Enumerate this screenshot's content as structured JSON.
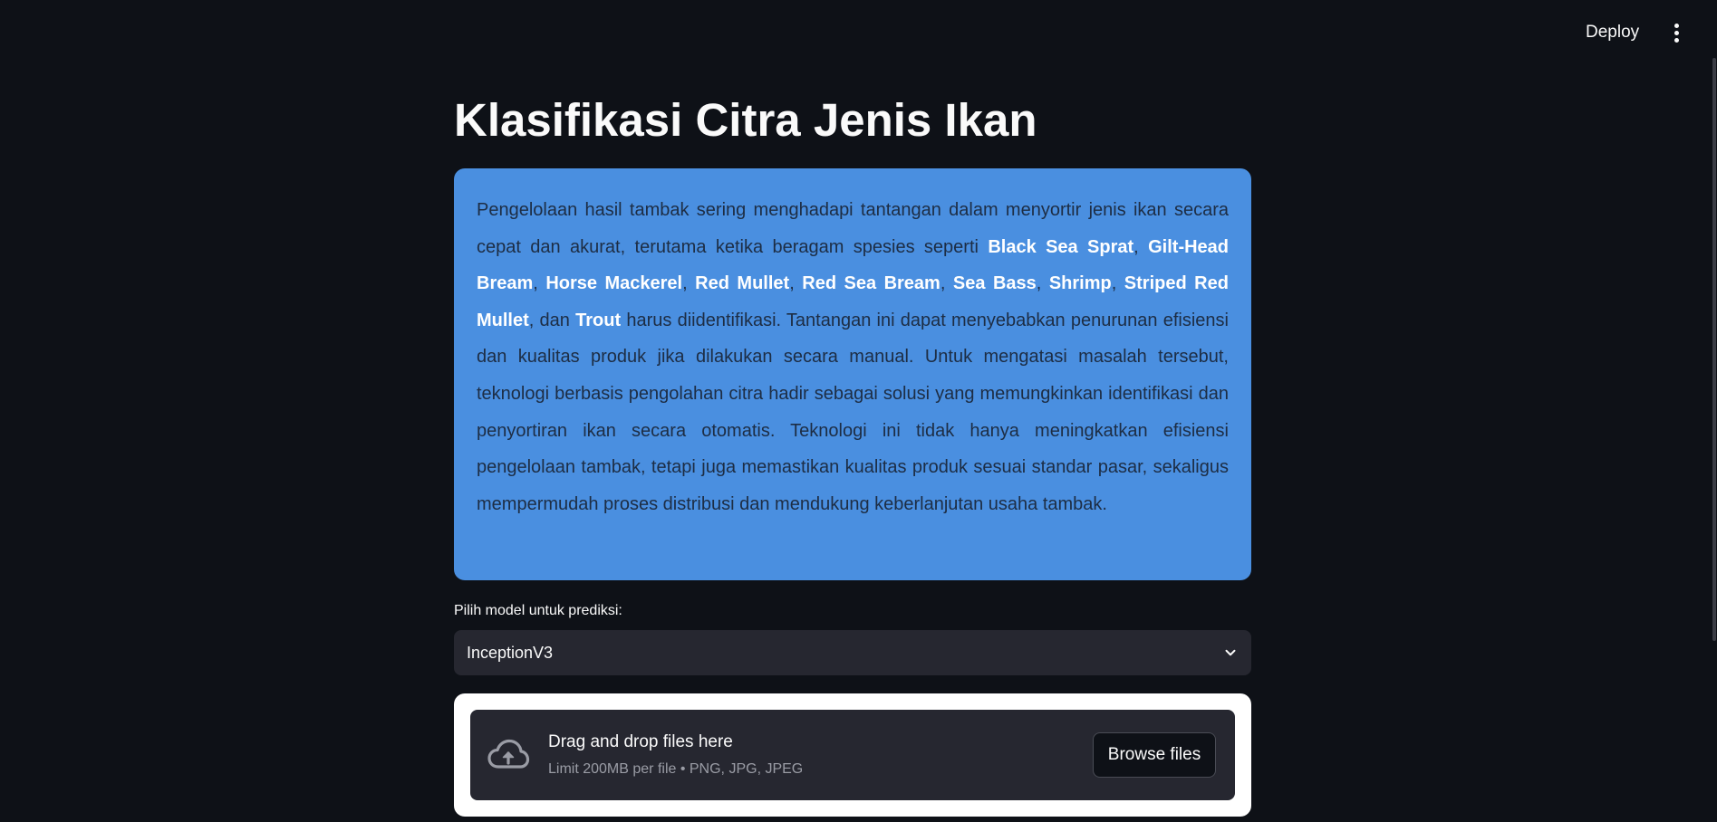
{
  "header": {
    "deploy_label": "Deploy",
    "menu_icon": "more-vertical-icon"
  },
  "main": {
    "title": "Klasifikasi Citra Jenis Ikan",
    "intro": {
      "before": "Pengelolaan hasil tambak sering menghadapi tantangan dalam menyortir jenis ikan secara cepat dan akurat, terutama ketika beragam spesies seperti ",
      "species": [
        "Black Sea Sprat",
        "Gilt-Head Bream",
        "Horse Mackerel",
        "Red Mullet",
        "Red Sea Bream",
        "Sea Bass",
        "Shrimp",
        "Striped Red Mullet",
        "Trout"
      ],
      "separator": ", ",
      "conjunction": ", dan ",
      "after": " harus diidentifikasi. Tantangan ini dapat menyebabkan penurunan efisiensi dan kualitas produk jika dilakukan secara manual. Untuk mengatasi masalah tersebut, teknologi berbasis pengolahan citra hadir sebagai solusi yang memungkinkan identifikasi dan penyortiran ikan secara otomatis. Teknologi ini tidak hanya meningkatkan efisiensi pengelolaan tambak, tetapi juga memastikan kualitas produk sesuai standar pasar, sekaligus mempermudah proses distribusi dan mendukung keberlanjutan usaha tambak.",
      "background_color": "#4a8fe0"
    },
    "model_select": {
      "label": "Pilih model untuk prediksi:",
      "value": "InceptionV3",
      "icon": "chevron-down-icon"
    },
    "uploader": {
      "icon": "cloud-upload-icon",
      "title": "Drag and drop files here",
      "subtitle": "Limit 200MB per file • PNG, JPG, JPEG",
      "browse_label": "Browse files"
    }
  }
}
